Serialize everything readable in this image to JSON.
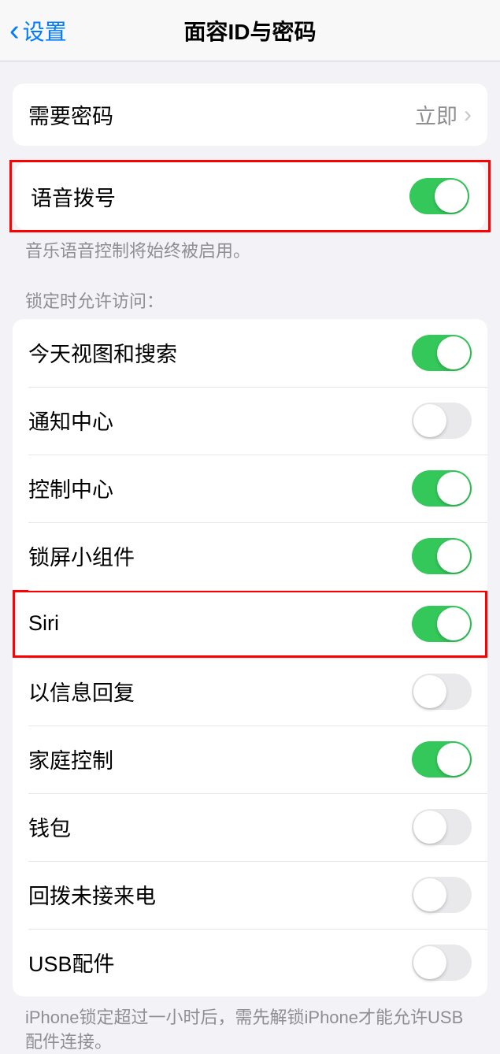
{
  "header": {
    "back_label": "设置",
    "title": "面容ID与密码"
  },
  "require_passcode": {
    "label": "需要密码",
    "value": "立即"
  },
  "voice_dial": {
    "label": "语音拨号",
    "footer": "音乐语音控制将始终被启用。"
  },
  "locked_section": {
    "header": "锁定时允许访问：",
    "items": [
      {
        "label": "今天视图和搜索",
        "on": true
      },
      {
        "label": "通知中心",
        "on": false
      },
      {
        "label": "控制中心",
        "on": true
      },
      {
        "label": "锁屏小组件",
        "on": true
      },
      {
        "label": "Siri",
        "on": true
      },
      {
        "label": "以信息回复",
        "on": false
      },
      {
        "label": "家庭控制",
        "on": true
      },
      {
        "label": "钱包",
        "on": false
      },
      {
        "label": "回拨未接来电",
        "on": false
      },
      {
        "label": "USB配件",
        "on": false
      }
    ],
    "footer": "iPhone锁定超过一小时后，需先解锁iPhone才能允许USB配件连接。"
  }
}
